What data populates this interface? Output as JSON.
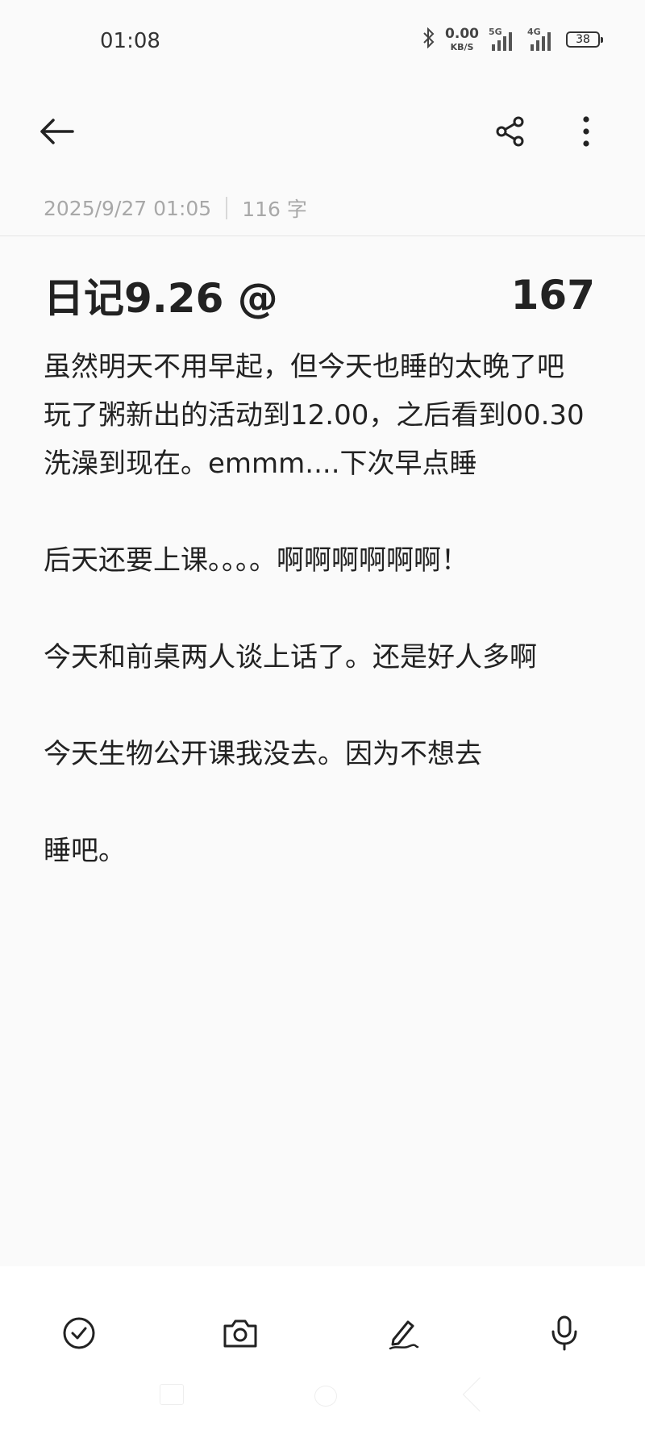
{
  "status_bar": {
    "time": "01:08",
    "net_speed_value": "0.00",
    "net_speed_unit": "KB/S",
    "signal1_label": "5G",
    "signal2_label": "4G",
    "battery": "38",
    "icons": [
      "bluetooth-icon",
      "signal-5g-icon",
      "signal-4g-icon",
      "battery-icon"
    ]
  },
  "toolbar": {
    "icons": [
      "back-arrow-icon",
      "share-icon",
      "more-vertical-icon"
    ]
  },
  "note": {
    "date": "2025/9/27 01:05",
    "word_count": "116 字",
    "title": "日记9.26  @",
    "title_number": "167",
    "body": [
      "虽然明天不用早起，但今天也睡的太晚了吧",
      "玩了粥新出的活动到12.00，之后看到00.30",
      "洗澡到现在。emmm....下次早点睡",
      "",
      "后天还要上课。。。。啊啊啊啊啊啊！",
      "",
      "今天和前桌两人谈上话了。还是好人多啊",
      "",
      "今天生物公开课我没去。因为不想去",
      "",
      "睡吧。"
    ]
  },
  "bottom_bar": {
    "icons": [
      "checklist-icon",
      "camera-icon",
      "handwriting-pen-icon",
      "microphone-icon"
    ]
  }
}
